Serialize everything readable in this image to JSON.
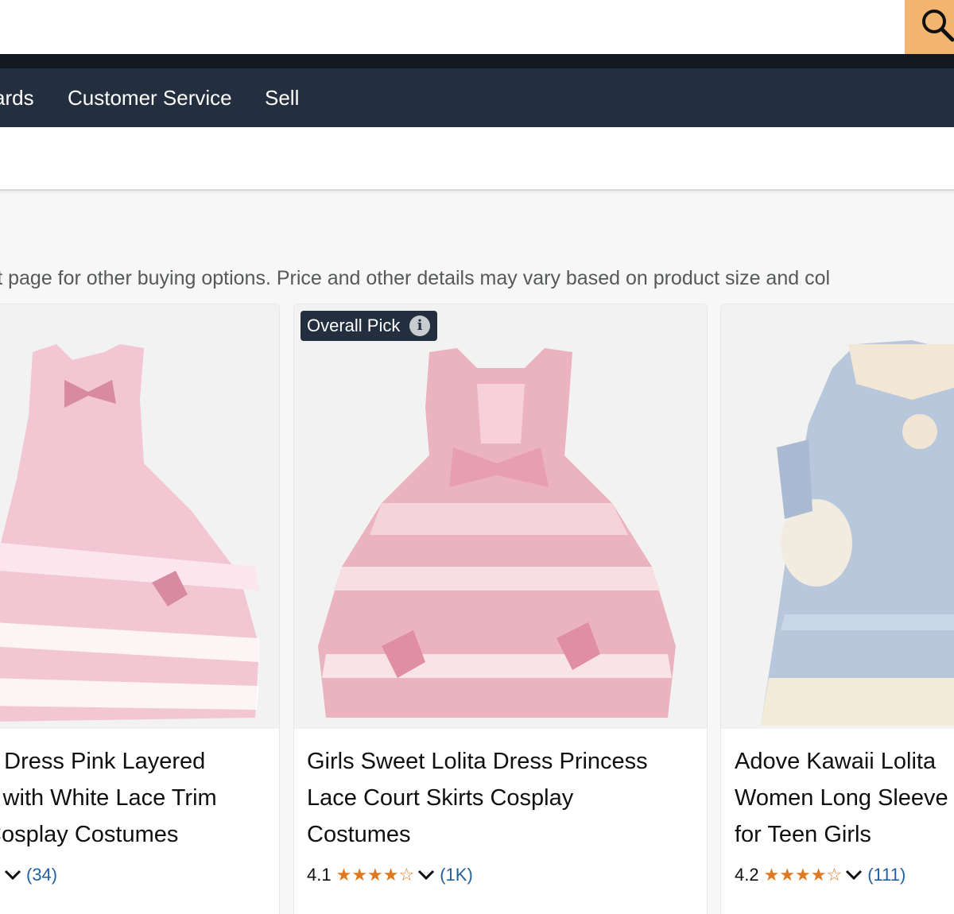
{
  "search": {
    "placeholder": "",
    "value": ""
  },
  "nav": {
    "items": [
      "ards",
      "Customer Service",
      "Sell"
    ]
  },
  "notice": "oduct page for other buying options. Price and other details may vary based on product size and col",
  "badge": {
    "label": "Overall Pick",
    "info_icon": "i"
  },
  "products": [
    {
      "title_lines": [
        "a Dress Pink Layered",
        "s with White Lace Trim",
        "Cosplay Costumes"
      ],
      "rating": "",
      "stars": "",
      "count": "(34)"
    },
    {
      "title_lines": [
        "Girls Sweet Lolita Dress Princess",
        "Lace Court Skirts Cosplay",
        "Costumes"
      ],
      "rating": "4.1",
      "stars": "★★★★☆",
      "count": "(1K)"
    },
    {
      "title_lines": [
        "Adove Kawaii Lolita",
        "Women Long Sleeve",
        "for Teen Girls"
      ],
      "rating": "4.2",
      "stars": "★★★★☆",
      "count": "(111)"
    }
  ],
  "colors": {
    "nav_bg": "#232f3e",
    "strip_bg": "#131921",
    "search_btn": "#f3b46f",
    "star": "#de7921",
    "link": "#2162a1"
  },
  "icons": {
    "search": "search-icon",
    "chevron": "chevron-down-icon",
    "info": "info-icon"
  }
}
